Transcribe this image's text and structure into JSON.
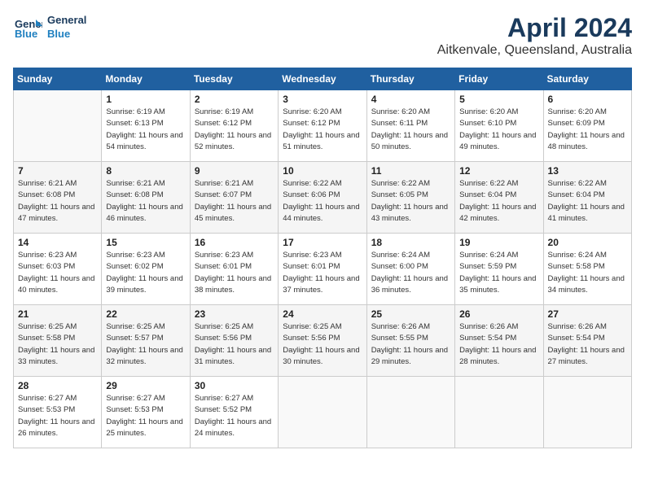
{
  "header": {
    "logo_line1": "General",
    "logo_line2": "Blue",
    "month": "April 2024",
    "location": "Aitkenvale, Queensland, Australia"
  },
  "weekdays": [
    "Sunday",
    "Monday",
    "Tuesday",
    "Wednesday",
    "Thursday",
    "Friday",
    "Saturday"
  ],
  "weeks": [
    [
      {
        "day": "",
        "sunrise": "",
        "sunset": "",
        "daylight": ""
      },
      {
        "day": "1",
        "sunrise": "Sunrise: 6:19 AM",
        "sunset": "Sunset: 6:13 PM",
        "daylight": "Daylight: 11 hours and 54 minutes."
      },
      {
        "day": "2",
        "sunrise": "Sunrise: 6:19 AM",
        "sunset": "Sunset: 6:12 PM",
        "daylight": "Daylight: 11 hours and 52 minutes."
      },
      {
        "day": "3",
        "sunrise": "Sunrise: 6:20 AM",
        "sunset": "Sunset: 6:12 PM",
        "daylight": "Daylight: 11 hours and 51 minutes."
      },
      {
        "day": "4",
        "sunrise": "Sunrise: 6:20 AM",
        "sunset": "Sunset: 6:11 PM",
        "daylight": "Daylight: 11 hours and 50 minutes."
      },
      {
        "day": "5",
        "sunrise": "Sunrise: 6:20 AM",
        "sunset": "Sunset: 6:10 PM",
        "daylight": "Daylight: 11 hours and 49 minutes."
      },
      {
        "day": "6",
        "sunrise": "Sunrise: 6:20 AM",
        "sunset": "Sunset: 6:09 PM",
        "daylight": "Daylight: 11 hours and 48 minutes."
      }
    ],
    [
      {
        "day": "7",
        "sunrise": "Sunrise: 6:21 AM",
        "sunset": "Sunset: 6:08 PM",
        "daylight": "Daylight: 11 hours and 47 minutes."
      },
      {
        "day": "8",
        "sunrise": "Sunrise: 6:21 AM",
        "sunset": "Sunset: 6:08 PM",
        "daylight": "Daylight: 11 hours and 46 minutes."
      },
      {
        "day": "9",
        "sunrise": "Sunrise: 6:21 AM",
        "sunset": "Sunset: 6:07 PM",
        "daylight": "Daylight: 11 hours and 45 minutes."
      },
      {
        "day": "10",
        "sunrise": "Sunrise: 6:22 AM",
        "sunset": "Sunset: 6:06 PM",
        "daylight": "Daylight: 11 hours and 44 minutes."
      },
      {
        "day": "11",
        "sunrise": "Sunrise: 6:22 AM",
        "sunset": "Sunset: 6:05 PM",
        "daylight": "Daylight: 11 hours and 43 minutes."
      },
      {
        "day": "12",
        "sunrise": "Sunrise: 6:22 AM",
        "sunset": "Sunset: 6:04 PM",
        "daylight": "Daylight: 11 hours and 42 minutes."
      },
      {
        "day": "13",
        "sunrise": "Sunrise: 6:22 AM",
        "sunset": "Sunset: 6:04 PM",
        "daylight": "Daylight: 11 hours and 41 minutes."
      }
    ],
    [
      {
        "day": "14",
        "sunrise": "Sunrise: 6:23 AM",
        "sunset": "Sunset: 6:03 PM",
        "daylight": "Daylight: 11 hours and 40 minutes."
      },
      {
        "day": "15",
        "sunrise": "Sunrise: 6:23 AM",
        "sunset": "Sunset: 6:02 PM",
        "daylight": "Daylight: 11 hours and 39 minutes."
      },
      {
        "day": "16",
        "sunrise": "Sunrise: 6:23 AM",
        "sunset": "Sunset: 6:01 PM",
        "daylight": "Daylight: 11 hours and 38 minutes."
      },
      {
        "day": "17",
        "sunrise": "Sunrise: 6:23 AM",
        "sunset": "Sunset: 6:01 PM",
        "daylight": "Daylight: 11 hours and 37 minutes."
      },
      {
        "day": "18",
        "sunrise": "Sunrise: 6:24 AM",
        "sunset": "Sunset: 6:00 PM",
        "daylight": "Daylight: 11 hours and 36 minutes."
      },
      {
        "day": "19",
        "sunrise": "Sunrise: 6:24 AM",
        "sunset": "Sunset: 5:59 PM",
        "daylight": "Daylight: 11 hours and 35 minutes."
      },
      {
        "day": "20",
        "sunrise": "Sunrise: 6:24 AM",
        "sunset": "Sunset: 5:58 PM",
        "daylight": "Daylight: 11 hours and 34 minutes."
      }
    ],
    [
      {
        "day": "21",
        "sunrise": "Sunrise: 6:25 AM",
        "sunset": "Sunset: 5:58 PM",
        "daylight": "Daylight: 11 hours and 33 minutes."
      },
      {
        "day": "22",
        "sunrise": "Sunrise: 6:25 AM",
        "sunset": "Sunset: 5:57 PM",
        "daylight": "Daylight: 11 hours and 32 minutes."
      },
      {
        "day": "23",
        "sunrise": "Sunrise: 6:25 AM",
        "sunset": "Sunset: 5:56 PM",
        "daylight": "Daylight: 11 hours and 31 minutes."
      },
      {
        "day": "24",
        "sunrise": "Sunrise: 6:25 AM",
        "sunset": "Sunset: 5:56 PM",
        "daylight": "Daylight: 11 hours and 30 minutes."
      },
      {
        "day": "25",
        "sunrise": "Sunrise: 6:26 AM",
        "sunset": "Sunset: 5:55 PM",
        "daylight": "Daylight: 11 hours and 29 minutes."
      },
      {
        "day": "26",
        "sunrise": "Sunrise: 6:26 AM",
        "sunset": "Sunset: 5:54 PM",
        "daylight": "Daylight: 11 hours and 28 minutes."
      },
      {
        "day": "27",
        "sunrise": "Sunrise: 6:26 AM",
        "sunset": "Sunset: 5:54 PM",
        "daylight": "Daylight: 11 hours and 27 minutes."
      }
    ],
    [
      {
        "day": "28",
        "sunrise": "Sunrise: 6:27 AM",
        "sunset": "Sunset: 5:53 PM",
        "daylight": "Daylight: 11 hours and 26 minutes."
      },
      {
        "day": "29",
        "sunrise": "Sunrise: 6:27 AM",
        "sunset": "Sunset: 5:53 PM",
        "daylight": "Daylight: 11 hours and 25 minutes."
      },
      {
        "day": "30",
        "sunrise": "Sunrise: 6:27 AM",
        "sunset": "Sunset: 5:52 PM",
        "daylight": "Daylight: 11 hours and 24 minutes."
      },
      {
        "day": "",
        "sunrise": "",
        "sunset": "",
        "daylight": ""
      },
      {
        "day": "",
        "sunrise": "",
        "sunset": "",
        "daylight": ""
      },
      {
        "day": "",
        "sunrise": "",
        "sunset": "",
        "daylight": ""
      },
      {
        "day": "",
        "sunrise": "",
        "sunset": "",
        "daylight": ""
      }
    ]
  ]
}
